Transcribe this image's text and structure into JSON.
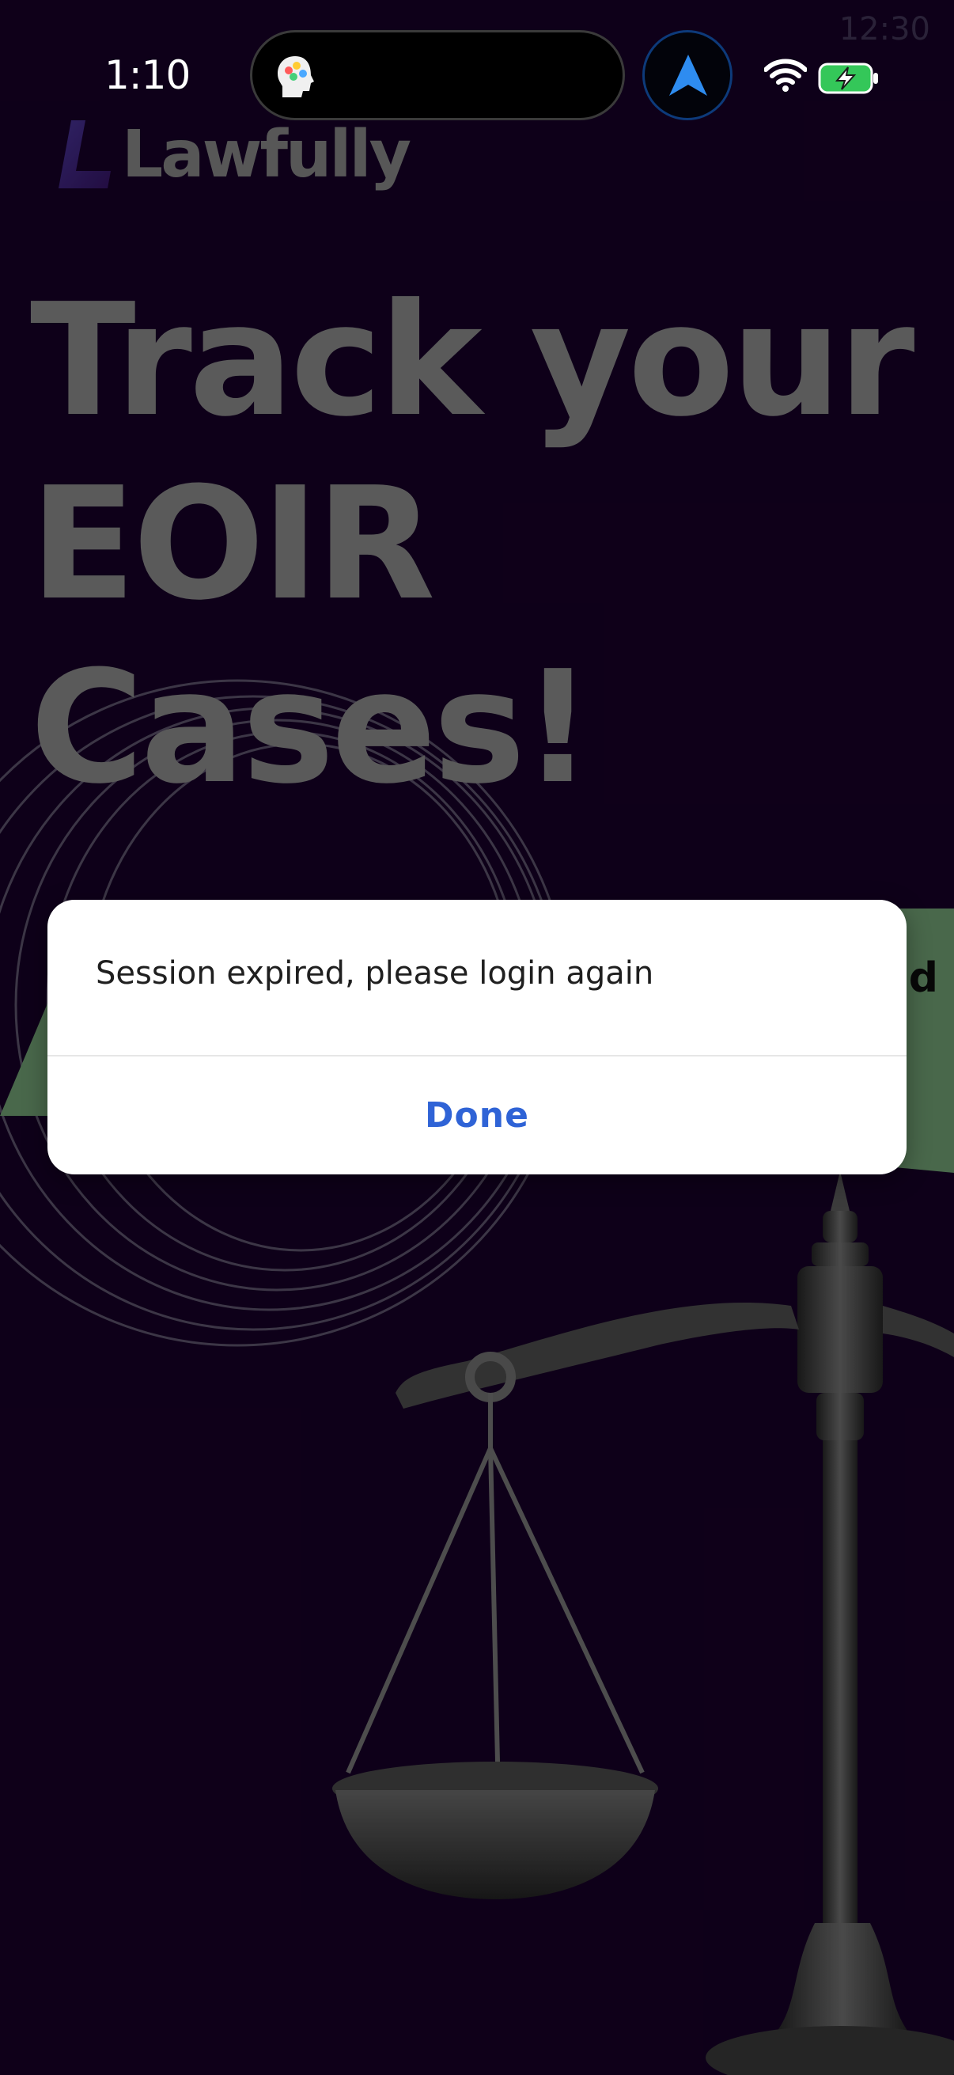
{
  "status_bar": {
    "time": "1:10",
    "ghost_time": "12:30",
    "icons": [
      "app-icon",
      "navigation-arrow-icon",
      "wifi-icon",
      "battery-charging-icon"
    ]
  },
  "app": {
    "logo_text": "Lawfully",
    "headline": [
      "Track your",
      "EOIR",
      "Cases!"
    ],
    "banner_text": "d"
  },
  "dialog": {
    "message": "Session expired, please login again",
    "button_label": "Done"
  },
  "colors": {
    "background": "#12001f",
    "dialog_button": "#2f63d6",
    "banner": "#5a7f5c",
    "battery": "#34c759"
  }
}
